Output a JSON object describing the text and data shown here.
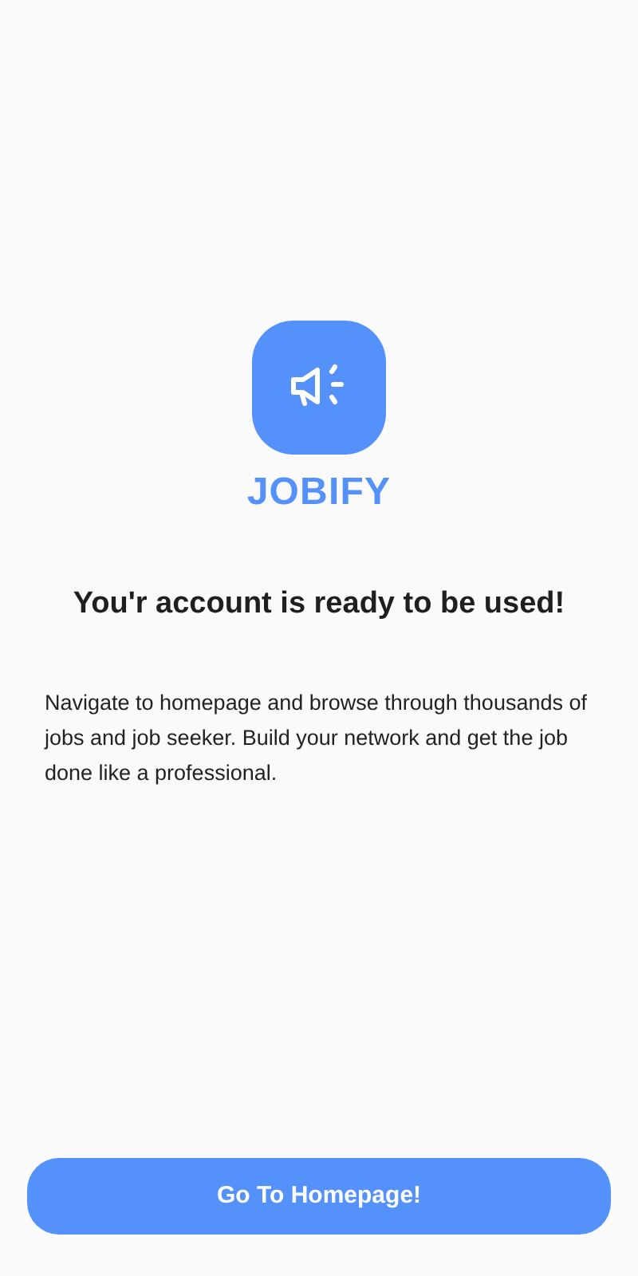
{
  "brand": {
    "name": "JOBIFY"
  },
  "heading": "You'r account is ready to be used!",
  "description": "Navigate to homepage and browse through thousands of jobs and job seeker. Build your network and get the job done like a professional.",
  "button": {
    "label": "Go To Homepage!"
  }
}
